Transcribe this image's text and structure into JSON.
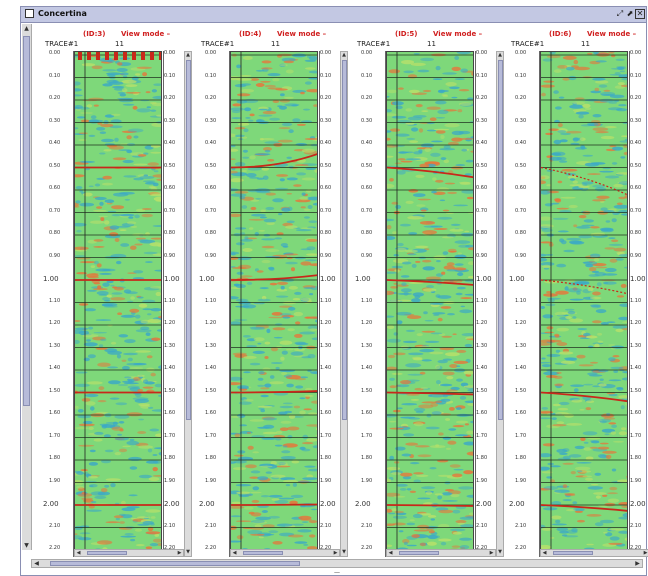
{
  "window": {
    "title": "Concertina",
    "buttons": {
      "restore": "⤢",
      "maximize": "⬈",
      "close": "✕"
    }
  },
  "time_axis": {
    "major": [
      "0.00",
      "0.10",
      "0.20",
      "0.30",
      "0.40",
      "0.50",
      "0.60",
      "0.70",
      "0.80",
      "0.90",
      "1.00",
      "1.10",
      "1.20",
      "1.30",
      "1.40",
      "1.50",
      "1.60",
      "1.70",
      "1.80",
      "1.90",
      "2.00",
      "2.10",
      "2.20"
    ],
    "major_right": [
      "0.00",
      "0.10",
      "0.20",
      "0.30",
      "0.40",
      "0.50",
      "0.60",
      "0.70",
      "0.80",
      "0.90",
      "1.00",
      "1.10",
      "1.20",
      "1.30",
      "1.40",
      "1.50",
      "1.60",
      "1.70",
      "1.80",
      "1.90",
      "2.00",
      "2.10",
      "2.20"
    ]
  },
  "panels": [
    {
      "id_label": "(ID:3)",
      "view_mode_label": "View mode –",
      "trace_label": "TRACE#1",
      "trace_value": "11"
    },
    {
      "id_label": "(ID:4)",
      "view_mode_label": "View mode –",
      "trace_label": "TRACE#1",
      "trace_value": "11"
    },
    {
      "id_label": "(ID:5)",
      "view_mode_label": "View mode –",
      "trace_label": "TRACE#1",
      "trace_value": "11"
    },
    {
      "id_label": "(ID:6)",
      "view_mode_label": "View mode –",
      "trace_label": "TRACE#1",
      "trace_value": "11"
    }
  ],
  "colors": {
    "seismic_background": "#7ed87a",
    "seismic_low": "#3aa8c8",
    "seismic_high": "#e8743a",
    "reflector": "#c8281a",
    "header_text": "#d02020",
    "scroll_thumb": "#b7bbd9"
  },
  "status_text": "—"
}
